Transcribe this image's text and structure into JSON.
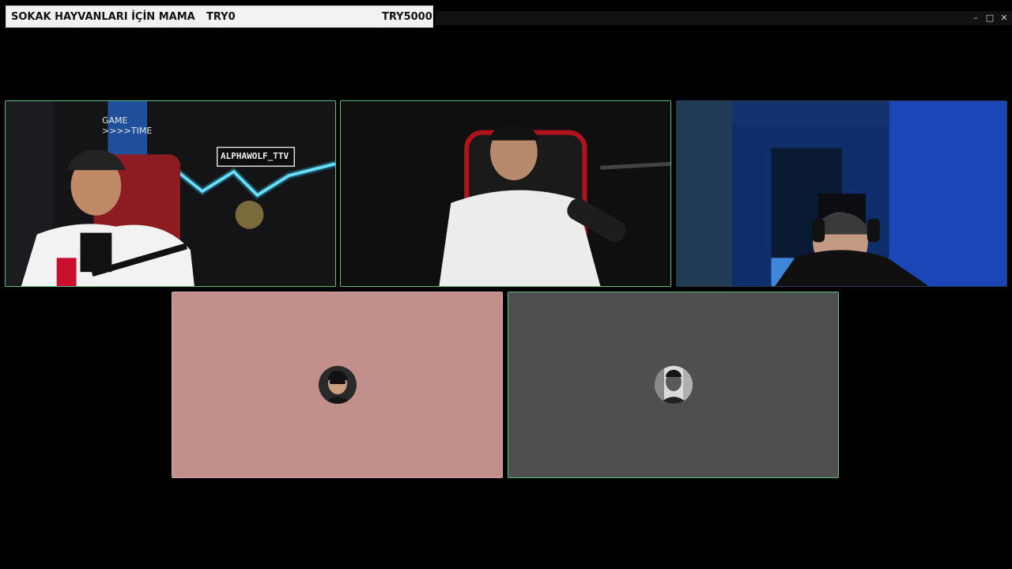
{
  "donation_bar": {
    "campaign": "SOKAK HAYVANLARI İÇİN MAMA",
    "raised": "TRY0",
    "goal": "TRY5000"
  },
  "window_controls": {
    "minimize": "–",
    "maximize": "□",
    "close": "✕"
  },
  "participants": [
    {
      "id": "p1",
      "video": "on",
      "overlay_text": "ALPHAWOLF_TTV",
      "sign_text_1": "GAME",
      "sign_text_2": ">>>>TIME"
    },
    {
      "id": "p2",
      "video": "on"
    },
    {
      "id": "p3",
      "video": "on"
    },
    {
      "id": "p4",
      "video": "off",
      "bg_color": "#c1908a"
    },
    {
      "id": "p5",
      "video": "off",
      "bg_color": "#4f4f4f"
    }
  ]
}
